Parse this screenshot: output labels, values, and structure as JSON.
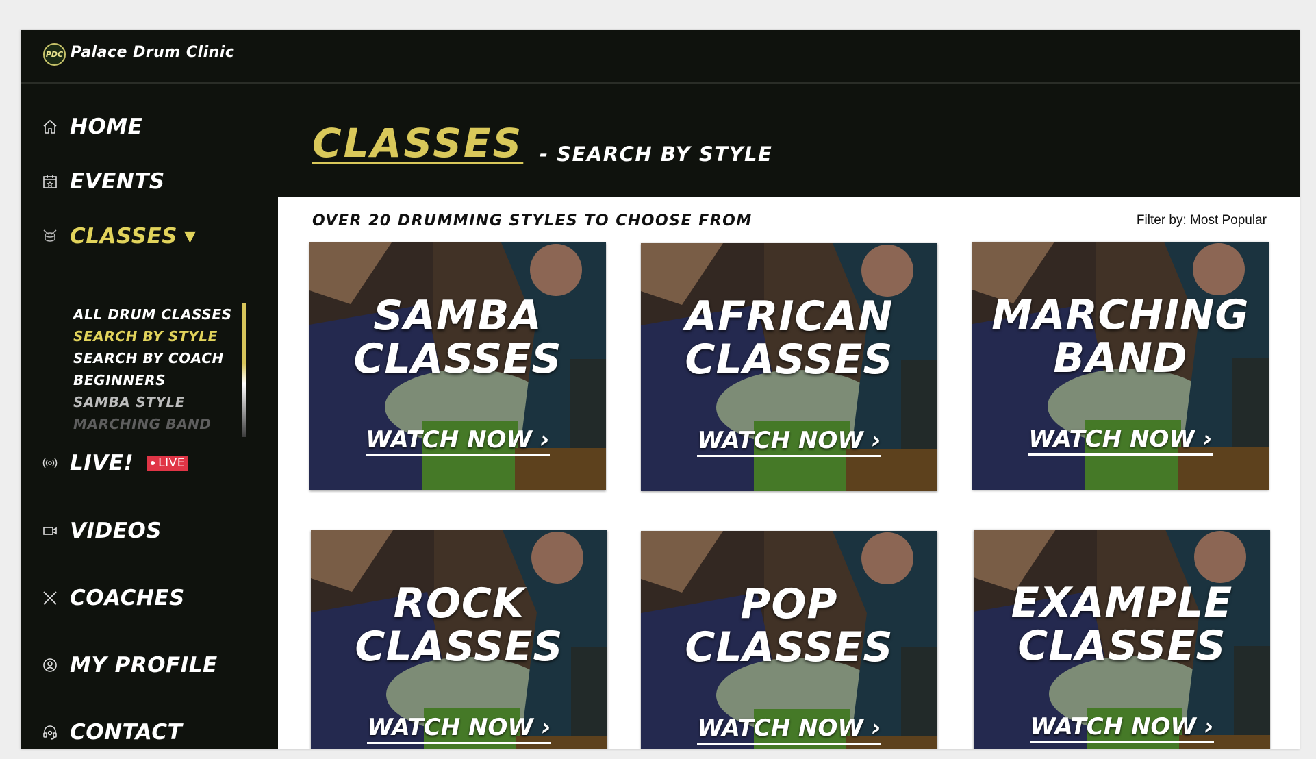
{
  "app": {
    "brand": "Palace Drum Clinic",
    "logo_text": "PDC"
  },
  "sidebar": {
    "items": [
      {
        "label": "HOME",
        "icon": "home-icon"
      },
      {
        "label": "EVENTS",
        "icon": "calendar-icon"
      },
      {
        "label": "CLASSES",
        "icon": "drum-icon",
        "caret": "▼"
      },
      {
        "label": "LIVE!",
        "icon": "broadcast-icon",
        "badge": "LIVE"
      },
      {
        "label": "VIDEOS",
        "icon": "video-icon"
      },
      {
        "label": "COACHES",
        "icon": "drumsticks-icon"
      },
      {
        "label": "MY PROFILE",
        "icon": "user-circle-icon"
      },
      {
        "label": "CONTACT",
        "icon": "headset-icon"
      }
    ],
    "submenu": [
      "ALL DRUM CLASSES",
      "SEARCH BY STYLE",
      "SEARCH BY COACH",
      "BEGINNERS",
      "SAMBA STYLE",
      "MARCHING BAND"
    ]
  },
  "header": {
    "title": "CLASSES",
    "subtitle": "- SEARCH BY STYLE"
  },
  "content": {
    "heading": "OVER 20 DRUMMING STYLES TO CHOOSE FROM",
    "filter": "Filter by: Most Popular",
    "cards": [
      {
        "line1": "SAMBA",
        "line2": "CLASSES",
        "cta": "WATCH NOW ›"
      },
      {
        "line1": "AFRICAN",
        "line2": "CLASSES",
        "cta": "WATCH NOW ›"
      },
      {
        "line1": "MARCHING",
        "line2": "BAND",
        "cta": "WATCH NOW ›"
      },
      {
        "line1": "ROCK",
        "line2": "CLASSES",
        "cta": "WATCH NOW ›"
      },
      {
        "line1": "POP",
        "line2": "CLASSES",
        "cta": "WATCH NOW ›"
      },
      {
        "line1": "EXAMPLE",
        "line2": "CLASSES",
        "cta": "WATCH NOW ›"
      }
    ]
  },
  "colors": {
    "accent": "#d9c85a",
    "background": "#0f120d",
    "live": "#e03546"
  }
}
